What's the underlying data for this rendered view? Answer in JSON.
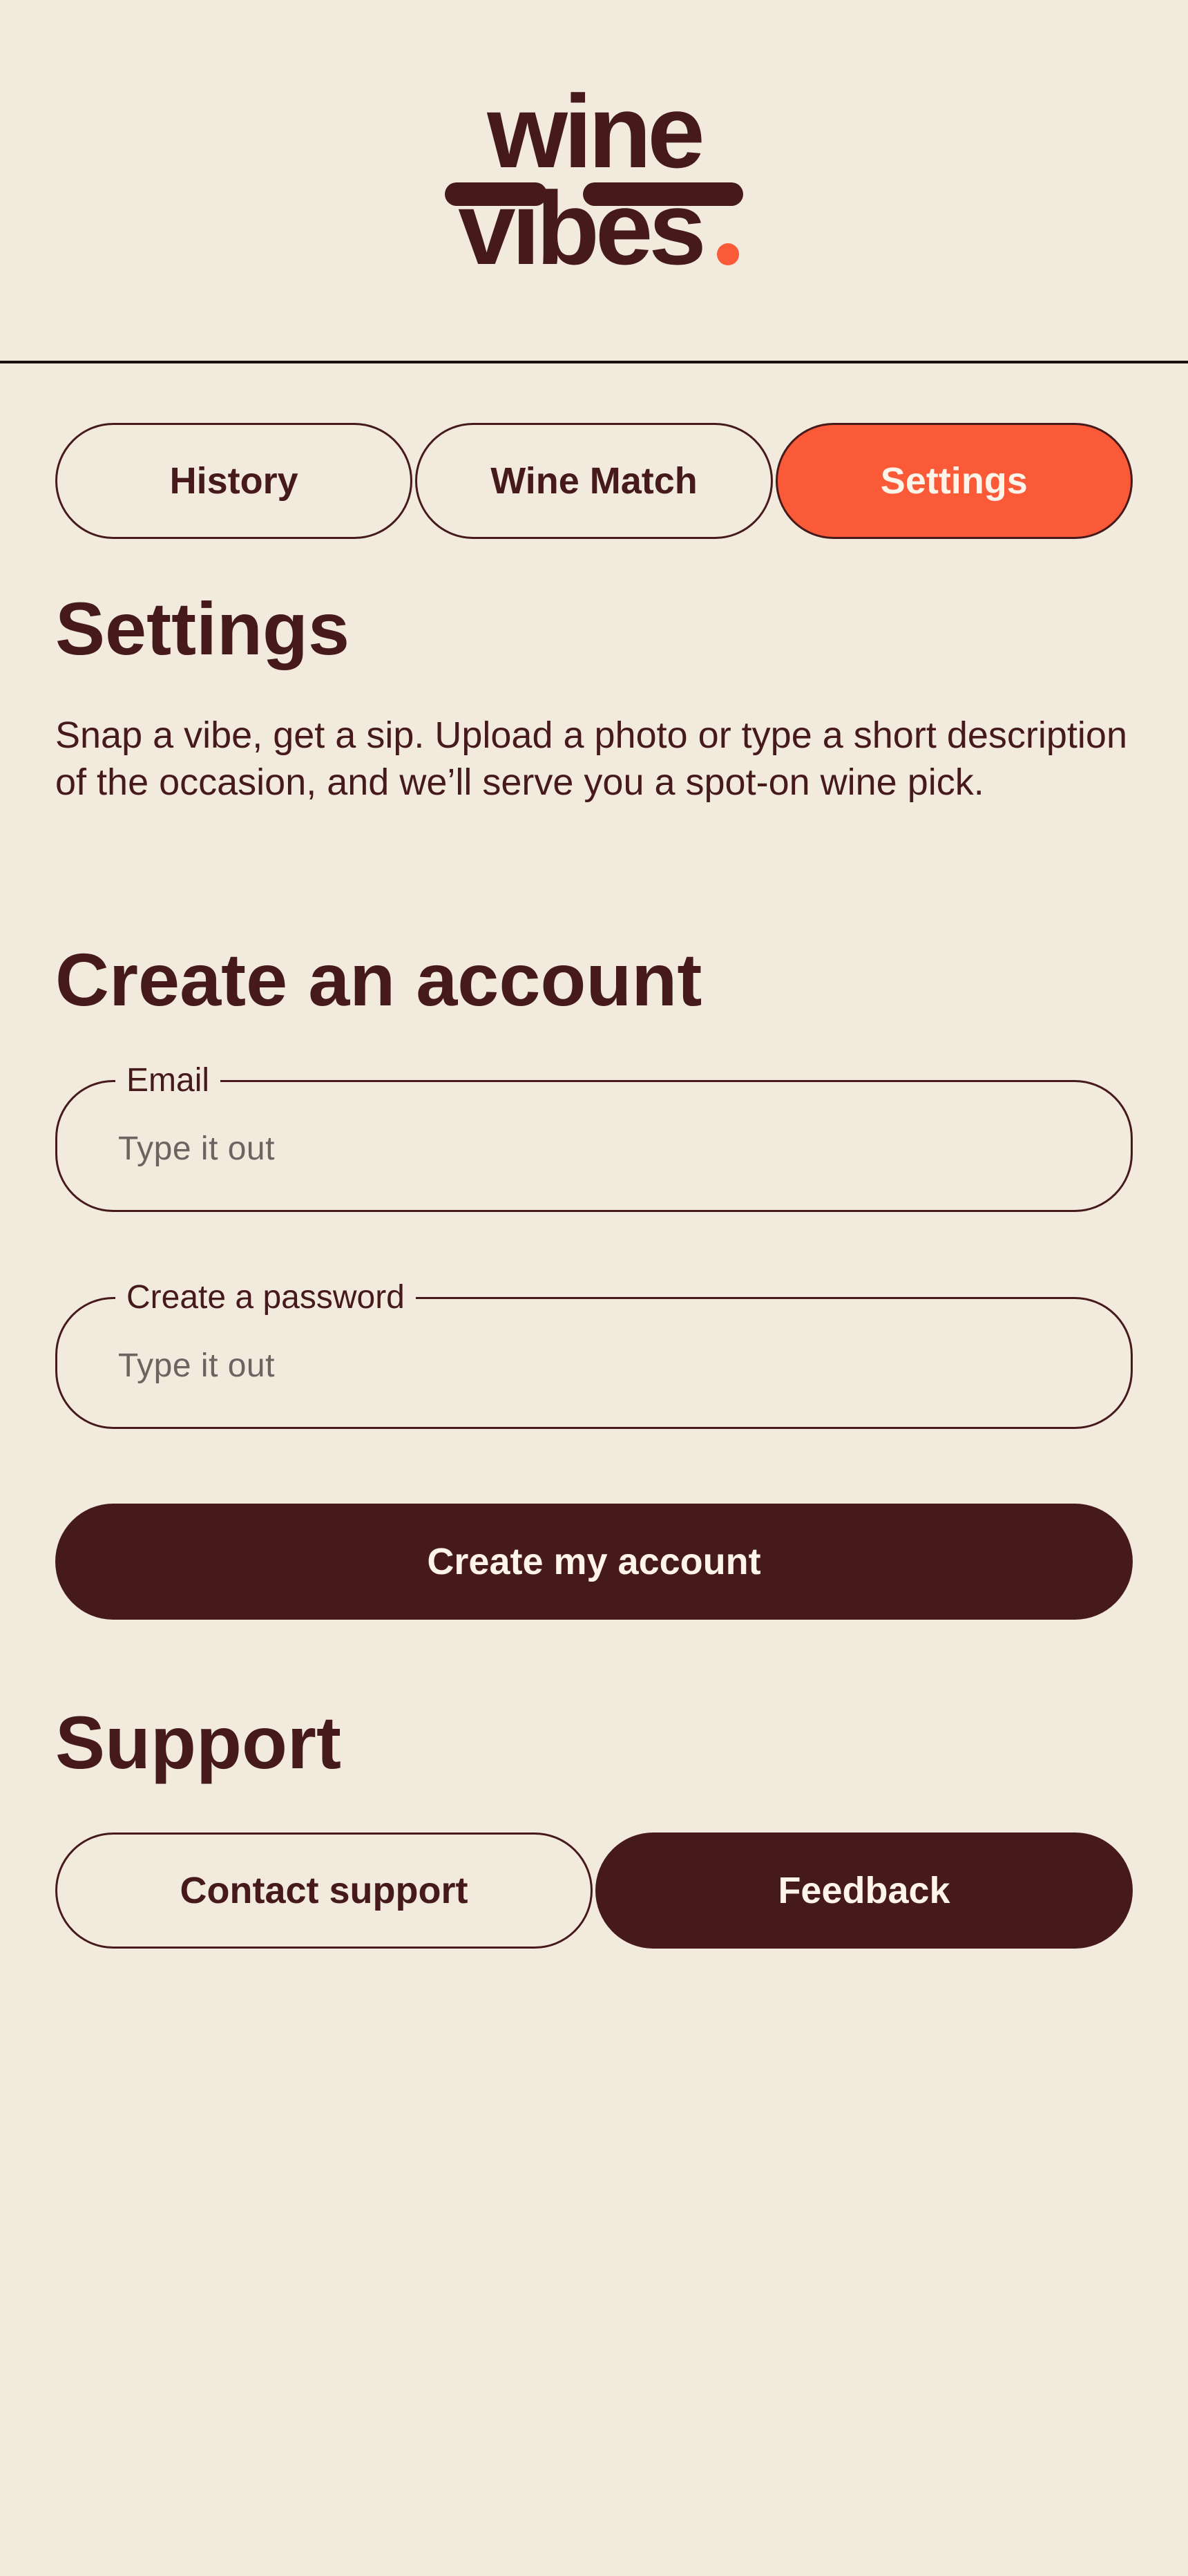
{
  "brand": {
    "logo_line1": "wine",
    "logo_line2": "vibes",
    "logo_color": "#461A1A",
    "dot_color": "#FA5A37"
  },
  "tabs": [
    {
      "label": "History",
      "active": false
    },
    {
      "label": "Wine Match",
      "active": false
    },
    {
      "label": "Settings",
      "active": true
    }
  ],
  "page": {
    "title": "Settings",
    "intro": "Snap a vibe, get a sip. Upload a photo or type a short description of the occasion, and we’ll serve you a spot-on wine pick."
  },
  "account": {
    "heading": "Create an account",
    "email_label": "Email",
    "email_placeholder": "Type it out",
    "email_value": "",
    "password_label": "Create a password",
    "password_placeholder": "Type it out",
    "password_value": "",
    "submit_label": "Create my account"
  },
  "support": {
    "heading": "Support",
    "contact_label": "Contact support",
    "feedback_label": "Feedback"
  },
  "colors": {
    "background": "#F1EADD",
    "primary": "#461A1A",
    "accent": "#FA5A37",
    "on_dark_text": "#FFF4EA",
    "placeholder": "#6B6461"
  }
}
